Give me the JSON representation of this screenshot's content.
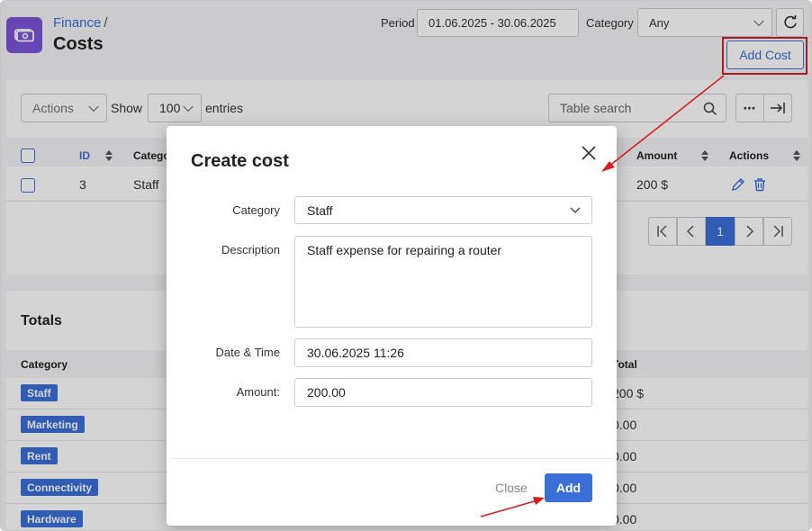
{
  "header": {
    "breadcrumb_parent": "Finance",
    "breadcrumb_sep": "/",
    "title": "Costs",
    "period_label": "Period",
    "period_value": "01.06.2025 - 30.06.2025",
    "category_label": "Category",
    "category_value": "Any",
    "add_cost_label": "Add Cost"
  },
  "toolbar": {
    "actions_label": "Actions",
    "show_label": "Show",
    "entries_count": "100",
    "entries_label": "entries",
    "search_placeholder": "Table search"
  },
  "table": {
    "headers": {
      "id": "ID",
      "category": "Category",
      "amount": "Amount",
      "actions": "Actions"
    },
    "rows": [
      {
        "id": "3",
        "category": "Staff",
        "amount": "200 $"
      }
    ]
  },
  "pagination": {
    "current": "1"
  },
  "totals": {
    "title": "Totals",
    "col_category": "Category",
    "col_total": "Total",
    "rows": [
      {
        "category": "Staff",
        "total": "200 $"
      },
      {
        "category": "Marketing",
        "total": "0.00"
      },
      {
        "category": "Rent",
        "total": "0.00"
      },
      {
        "category": "Connectivity",
        "total": "0.00"
      },
      {
        "category": "Hardware",
        "total": "0.00"
      }
    ]
  },
  "modal": {
    "title": "Create cost",
    "category_label": "Category",
    "category_value": "Staff",
    "description_label": "Description",
    "description_value": "Staff expense for repairing a router",
    "datetime_label": "Date & Time",
    "datetime_value": "30.06.2025 11:26",
    "amount_label": "Amount:",
    "amount_value": "200.00",
    "close_label": "Close",
    "add_label": "Add"
  },
  "colors": {
    "accent": "#3a6fd8",
    "brand_icon": "#7b55d9",
    "annotation": "#d21f1f"
  }
}
